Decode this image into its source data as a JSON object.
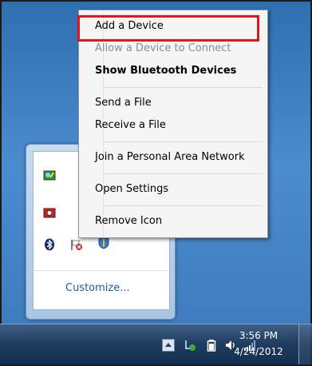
{
  "context_menu": {
    "items": [
      {
        "label": "Add a Device",
        "state": "highlighted"
      },
      {
        "label": "Allow a Device to Connect",
        "state": "disabled"
      },
      {
        "label": "Show Bluetooth Devices",
        "state": "default"
      },
      {
        "label": "Send a File",
        "state": "normal"
      },
      {
        "label": "Receive a File",
        "state": "normal"
      },
      {
        "label": "Join a Personal Area Network",
        "state": "normal"
      },
      {
        "label": "Open Settings",
        "state": "normal"
      },
      {
        "label": "Remove Icon",
        "state": "normal"
      }
    ]
  },
  "tray_flyout": {
    "customize_label": "Customize...",
    "icons": [
      "monitor-check-icon",
      "camera-icon",
      "bluetooth-icon",
      "action-center-flag-icon",
      "shield-icon"
    ]
  },
  "taskbar": {
    "time": "3:56 PM",
    "date": "4/24/2012",
    "icons": [
      "show-hidden-icons-arrow",
      "power-icon",
      "battery-icon",
      "volume-icon",
      "network-signal-icon"
    ]
  },
  "colors": {
    "highlight_border": "#e0161b",
    "link": "#1e5c9e"
  }
}
